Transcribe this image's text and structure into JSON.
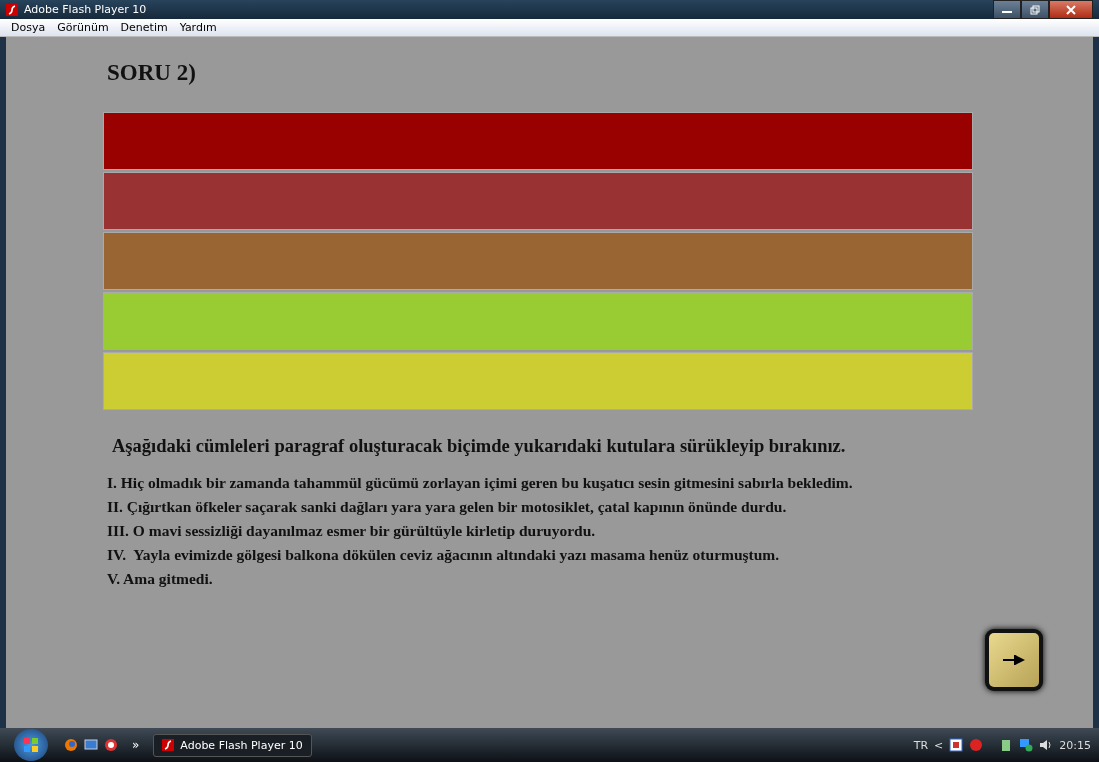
{
  "window": {
    "title": "Adobe Flash Player 10"
  },
  "menu": [
    "Dosya",
    "Görünüm",
    "Denetim",
    "Yardım"
  ],
  "question": {
    "title": "SORU 2)",
    "drop_boxes": [
      {
        "color": "#990000"
      },
      {
        "color": "#993333"
      },
      {
        "color": "#996633"
      },
      {
        "color": "#99cc33"
      },
      {
        "color": "#cccc33"
      }
    ],
    "instruction": "Aşağıdaki cümleleri paragraf oluşturacak biçimde yukarıdaki kutulara sürükleyip bırakınız.",
    "sentences": [
      "I. Hiç olmadık bir zamanda tahammül gücümü zorlayan içimi geren bu kuşatıcı sesin gitmesini sabırla bekledim.",
      "II. Çığırtkan öfkeler saçarak sanki dağları yara yara gelen bir motosiklet, çatal kapının önünde durdu.",
      "III. O mavi sessizliği dayanılmaz esmer bir gürültüyle kirletip duruyordu.",
      "IV.  Yayla evimizde gölgesi balkona dökülen ceviz ağacının altındaki yazı masama henüz oturmuştum.",
      "V. Ama gitmedi."
    ]
  },
  "taskbar": {
    "overflow": "»",
    "task": "Adobe Flash Player 10",
    "language": "TR",
    "tray_arrow": "<",
    "time": "20:15"
  }
}
